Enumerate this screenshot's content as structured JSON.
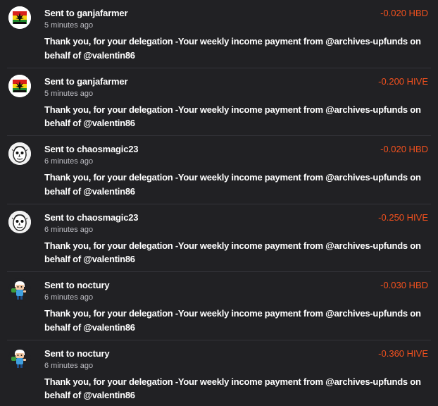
{
  "colors": {
    "background": "#212124",
    "amount_negative": "#f4511e",
    "separator": "#34343a",
    "secondary_text": "#bdbdc3"
  },
  "transactions": [
    {
      "prefix": "Sent to",
      "user": "ganjafarmer",
      "time": "5 minutes ago",
      "amount": "-0.020 HBD",
      "memo": "Thank you, for your delegation -Your weekly income payment from @archives-upfunds on behalf of @valentin86",
      "avatar_icon": "ganja-logo-icon"
    },
    {
      "prefix": "Sent to",
      "user": "ganjafarmer",
      "time": "5 minutes ago",
      "amount": "-0.200 HIVE",
      "memo": "Thank you, for your delegation -Your weekly income payment from @archives-upfunds on behalf of @valentin86",
      "avatar_icon": "ganja-logo-icon"
    },
    {
      "prefix": "Sent to",
      "user": "chaosmagic23",
      "time": "6 minutes ago",
      "amount": "-0.020 HBD",
      "memo": "Thank you, for your delegation -Your weekly income payment from @archives-upfunds on behalf of @valentin86",
      "avatar_icon": "sketch-face-icon"
    },
    {
      "prefix": "Sent to",
      "user": "chaosmagic23",
      "time": "6 minutes ago",
      "amount": "-0.250 HIVE",
      "memo": "Thank you, for your delegation -Your weekly income payment from @archives-upfunds on behalf of @valentin86",
      "avatar_icon": "sketch-face-icon"
    },
    {
      "prefix": "Sent to",
      "user": "noctury",
      "time": "6 minutes ago",
      "amount": "-0.030 HBD",
      "memo": "Thank you, for your delegation -Your weekly income payment from @archives-upfunds on behalf of @valentin86",
      "avatar_icon": "cartoon-character-icon"
    },
    {
      "prefix": "Sent to",
      "user": "noctury",
      "time": "6 minutes ago",
      "amount": "-0.360 HIVE",
      "memo": "Thank you, for your delegation -Your weekly income payment from @archives-upfunds on behalf of @valentin86",
      "avatar_icon": "cartoon-character-icon"
    }
  ]
}
